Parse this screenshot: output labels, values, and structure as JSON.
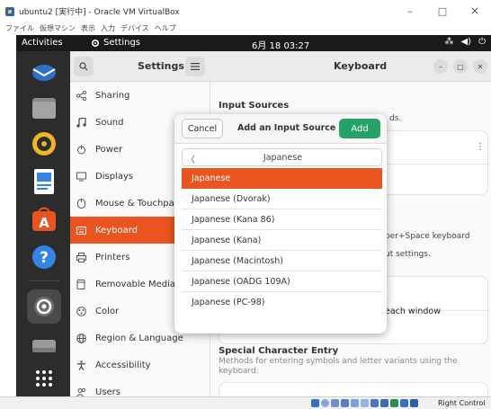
{
  "vbox": {
    "title": "ubuntu2 [実行中] - Oracle VM VirtualBox",
    "menu": [
      "ファイル",
      "仮想マシン",
      "表示",
      "入力",
      "デバイス",
      "ヘルプ"
    ],
    "controls": [
      "–",
      "□",
      "✕"
    ],
    "host_key": "Right Control"
  },
  "topbar": {
    "activities": "Activities",
    "app_name": "Settings",
    "clock": "6月 18 03:27"
  },
  "settings": {
    "header_title": "Settings",
    "panel_title": "Keyboard",
    "sidebar": [
      {
        "label": "Sharing",
        "icon": "share-icon"
      },
      {
        "label": "Sound",
        "icon": "music-note-icon"
      },
      {
        "label": "Power",
        "icon": "power-icon"
      },
      {
        "label": "Displays",
        "icon": "display-icon"
      },
      {
        "label": "Mouse & Touchpad",
        "icon": "mouse-icon"
      },
      {
        "label": "Keyboard",
        "icon": "keyboard-icon",
        "active": true
      },
      {
        "label": "Printers",
        "icon": "printer-icon"
      },
      {
        "label": "Removable Media",
        "icon": "media-icon"
      },
      {
        "label": "Color",
        "icon": "color-icon"
      },
      {
        "label": "Region & Language",
        "icon": "globe-icon"
      },
      {
        "label": "Accessibility",
        "icon": "accessibility-icon"
      },
      {
        "label": "Users",
        "icon": "users-icon"
      }
    ],
    "content": {
      "input_sources_title": "Input Sources",
      "frag_ds": "ds.",
      "frag_keyboard": "per+Space keyboard",
      "frag_settings": "ut settings.",
      "frag_window": "each window",
      "special_title": "Special Character Entry",
      "special_desc": "Methods for entering symbols and letter variants using the keyboard."
    }
  },
  "dialog": {
    "cancel": "Cancel",
    "title": "Add an Input Source",
    "add": "Add",
    "search_text": "Japanese",
    "back_glyph": "〈",
    "options": [
      "Japanese",
      "Japanese (Dvorak)",
      "Japanese (Kana 86)",
      "Japanese (Kana)",
      "Japanese (Macintosh)",
      "Japanese (OADG 109A)",
      "Japanese (PC-98)"
    ],
    "selected_index": 0
  },
  "colors": {
    "accent": "#e95420",
    "add_button": "#26a269",
    "dock": "#2c2c2c",
    "topbar": "#1a1a1a"
  }
}
